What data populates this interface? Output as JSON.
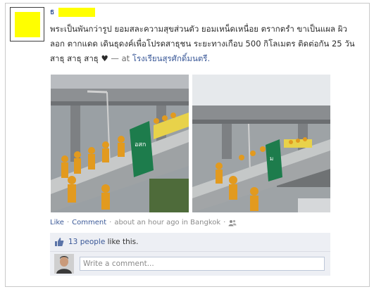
{
  "post": {
    "author_prefix": "ธ",
    "text_main": "พระเป็นพันกว่ารูป ยอมสละความสุขส่วนตัว ยอมเหน็ดเหนื่อย ตรากตรำ ขาเป็นแผล ผิวลอก ตากแดด เดินธุดงค์เพื่อโปรดสาธุชน ระยะทางเกือบ 500 กิโลเมตร ติดต่อกัน 25 วัน สาธุ สาธุ สาธุ ♥",
    "at_text": " — at ",
    "place": "โรงเรียนสุรศักดิ์มนตรี.",
    "photo_signs": [
      "อสก",
      "ม"
    ]
  },
  "actions": {
    "like": "Like",
    "sep1": " · ",
    "comment": "Comment",
    "sep2": " · ",
    "time": "about an hour ago in Bangkok",
    "sep3": " · "
  },
  "likes": {
    "count_link": "13 people",
    "suffix": "like this."
  },
  "comment_box": {
    "placeholder": "Write a comment..."
  },
  "colors": {
    "link": "#3b5998",
    "highlight": "#ffff00",
    "likes_bg": "#edeff4"
  }
}
